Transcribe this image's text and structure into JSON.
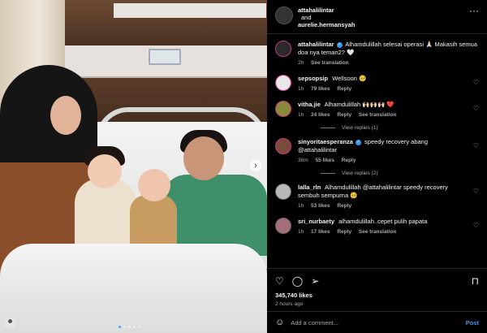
{
  "header": {
    "user1": "attahalilintar",
    "joiner": "and",
    "user2": "aurelie.hermansyah",
    "more": "···"
  },
  "caption": {
    "username": "attahalilintar",
    "text": "Alhamdulillah selesai operasi 🙏🏻 Makasih semua doa nya teman2? 🤍",
    "time": "2h",
    "see_translation": "See translation"
  },
  "comments": [
    {
      "username": "sepsopsip",
      "verified": false,
      "text": "Wellsoon 🥺",
      "time": "1h",
      "likes": "79 likes",
      "reply": "Reply",
      "see_translation": ""
    },
    {
      "username": "vitha.jie",
      "verified": false,
      "text": "Alhamdulillah 🙌🏻🙌🏻🙌🏻 ❤️",
      "time": "1h",
      "likes": "24 likes",
      "reply": "Reply",
      "see_translation": "See translation"
    },
    {
      "username": "sinyoritaesperanza",
      "verified": true,
      "text": "speedy recovery abang @attahalilintar",
      "time": "36m",
      "likes": "55 likes",
      "reply": "Reply",
      "see_translation": ""
    },
    {
      "username": "lalla_rln",
      "verified": false,
      "text": "Alhamdulillah @attahalilintar speedy recovery sembuh sempurna 🥺",
      "time": "1h",
      "likes": "53 likes",
      "reply": "Reply",
      "see_translation": ""
    },
    {
      "username": "sri_nurbaety",
      "verified": false,
      "text": "alhamdulillah..cepet pulih papata",
      "time": "1h",
      "likes": "17 likes",
      "reply": "Reply",
      "see_translation": "See translation"
    }
  ],
  "view_replies": [
    "View replies (1)",
    "View replies (2)"
  ],
  "actions": {
    "like_icon": "heart-icon",
    "comment_icon": "comment-icon",
    "share_icon": "share-icon",
    "save_icon": "bookmark-icon",
    "likes": "345,740 likes",
    "ago": "2 hours ago"
  },
  "add_comment": {
    "placeholder": "Add a comment...",
    "post": "Post"
  },
  "colors": {
    "background": "#000000",
    "link": "#4a90d9",
    "verified": "#3897f0",
    "muted": "#a8a8a8"
  }
}
